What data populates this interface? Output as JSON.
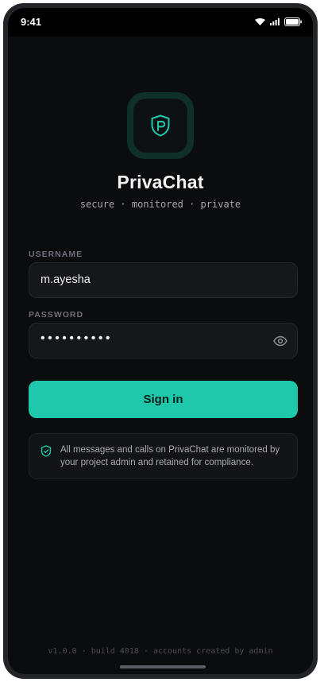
{
  "status_bar": {
    "time": "9:41",
    "icons": [
      "wifi-icon",
      "signal-icon",
      "battery-icon"
    ]
  },
  "app": {
    "logo_icon": "shield-p-icon",
    "title": "PrivaChat",
    "tagline": "secure · monitored · private"
  },
  "form": {
    "username_label": "USERNAME",
    "username_value": "m.ayesha",
    "password_label": "PASSWORD",
    "password_masked": "••••••••••",
    "password_toggle_icon": "eye-icon",
    "signin_label": "Sign in"
  },
  "notice": {
    "icon": "shield-check-icon",
    "text": "All messages and calls on PrivaChat are monitored by your project admin and retained for compliance."
  },
  "footer": {
    "text": "v1.0.0 · build 4018 · accounts created by admin"
  },
  "colors": {
    "accent": "#1fc8aa",
    "background": "#0b0c0e",
    "field": "#15171b"
  }
}
